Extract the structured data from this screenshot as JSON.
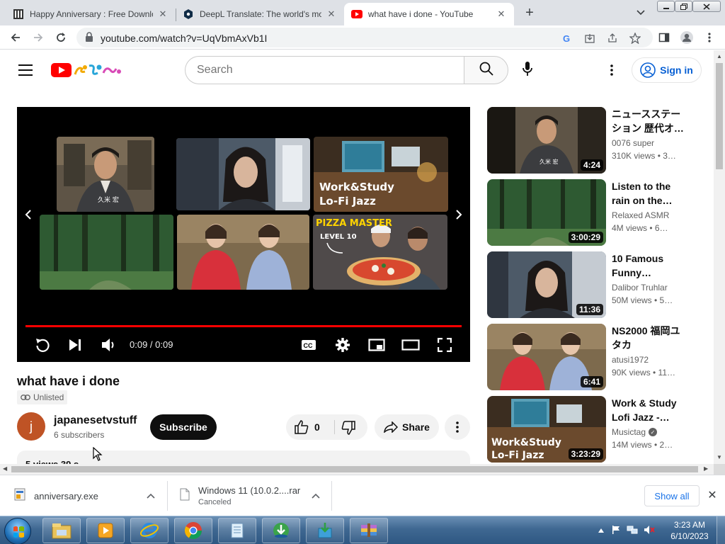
{
  "browser": {
    "tabs": [
      {
        "title": "Happy Anniversary : Free Downlo",
        "favicon": "library-icon"
      },
      {
        "title": "DeepL Translate: The world's mo",
        "favicon": "deepl-icon"
      },
      {
        "title": "what have i done - YouTube",
        "favicon": "youtube-icon",
        "active": true
      }
    ],
    "url": "youtube.com/watch?v=UqVbmAxVb1I"
  },
  "yt_header": {
    "search_placeholder": "Search",
    "sign_in": "Sign in"
  },
  "player": {
    "time": "0:09 / 0:09",
    "progress_fraction": 1.0,
    "endscreen_overlays": {
      "work_study": "Work&Study\nLo-Fi Jazz",
      "pizza": "PIZZA MASTER",
      "level": "LEVEL 10"
    }
  },
  "video": {
    "title": "what have i done",
    "visibility": "Unlisted",
    "channel": "japanesetvstuff",
    "channel_initial": "j",
    "subscribers": "6 subscribers",
    "subscribe_label": "Subscribe",
    "likes": "0",
    "share_label": "Share",
    "description_preview": "5 views  39 s"
  },
  "recommendations": [
    {
      "title": "ニュースステーション 歴代オ…",
      "channel": "0076 super",
      "meta": "310K views  •  3…",
      "duration": "4:24",
      "verified": false
    },
    {
      "title": "Listen to the rain on the…",
      "channel": "Relaxed ASMR",
      "meta": "4M views  •  6…",
      "duration": "3:00:29",
      "verified": false
    },
    {
      "title": "10 Famous Funny…",
      "channel": "Dalibor Truhlar",
      "meta": "50M views  •  5…",
      "duration": "11:36",
      "verified": false
    },
    {
      "title": "NS2000 福岡ユタカ",
      "channel": "atusi1972",
      "meta": "90K views  •  11…",
      "duration": "6:41",
      "verified": false
    },
    {
      "title": "Work & Study Lofi Jazz -…",
      "channel": "Musictag",
      "meta": "14M views  •  2…",
      "duration": "3:23:29",
      "verified": true
    }
  ],
  "downloads": [
    {
      "filename": "anniversary.exe",
      "status": ""
    },
    {
      "filename": "Windows 11 (10.0.2....rar",
      "status": "Canceled"
    }
  ],
  "downloads_show_all": "Show all",
  "taskbar": {
    "time": "3:23 AM",
    "date": "6/10/2023"
  },
  "colors": {
    "yt_red": "#ff0000",
    "link_blue": "#065fd4",
    "taskbar": "#2e5782"
  }
}
